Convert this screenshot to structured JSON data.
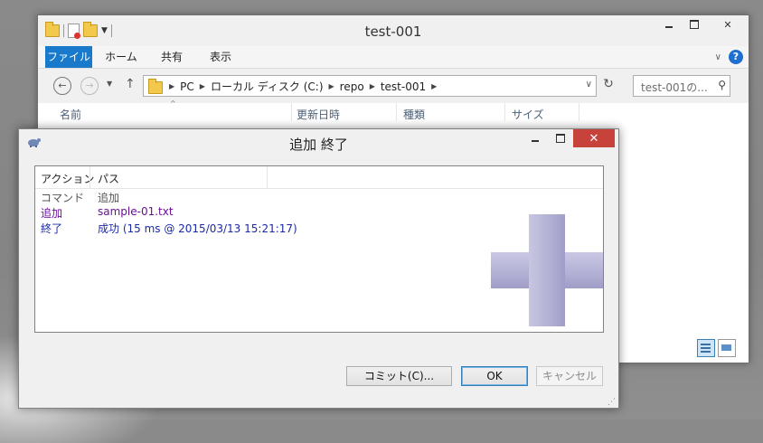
{
  "explorer": {
    "title": "test-001",
    "ribbon_tabs": [
      "ファイル",
      "ホーム",
      "共有",
      "表示"
    ],
    "breadcrumbs": [
      "PC",
      "ローカル ディスク (C:)",
      "repo",
      "test-001"
    ],
    "search_placeholder": "test-001の...",
    "columns": [
      "名前",
      "更新日時",
      "種類",
      "サイズ"
    ]
  },
  "dialog": {
    "title": "追加 終了",
    "columns": [
      "アクション",
      "パス"
    ],
    "rows": [
      {
        "action": "コマンド",
        "path": "追加",
        "color": "#555555"
      },
      {
        "action": "追加",
        "path": "sample-01.txt",
        "color": "#6a0f9a"
      },
      {
        "action": "終了",
        "path": "成功 (15 ms @ 2015/03/13 15:21:17)",
        "color": "#1a2aa8"
      }
    ],
    "buttons": {
      "commit": "コミット(C)...",
      "ok": "OK",
      "cancel": "キャンセル"
    }
  },
  "icons": [
    "folder-icon",
    "document-icon",
    "help-icon",
    "tortoise-icon",
    "add-watermark-icon"
  ],
  "colors": {
    "file_tab": "#1979ca",
    "close_button": "#c7423b",
    "added_text": "#6a0f9a",
    "finished_text": "#1a2aa8"
  }
}
